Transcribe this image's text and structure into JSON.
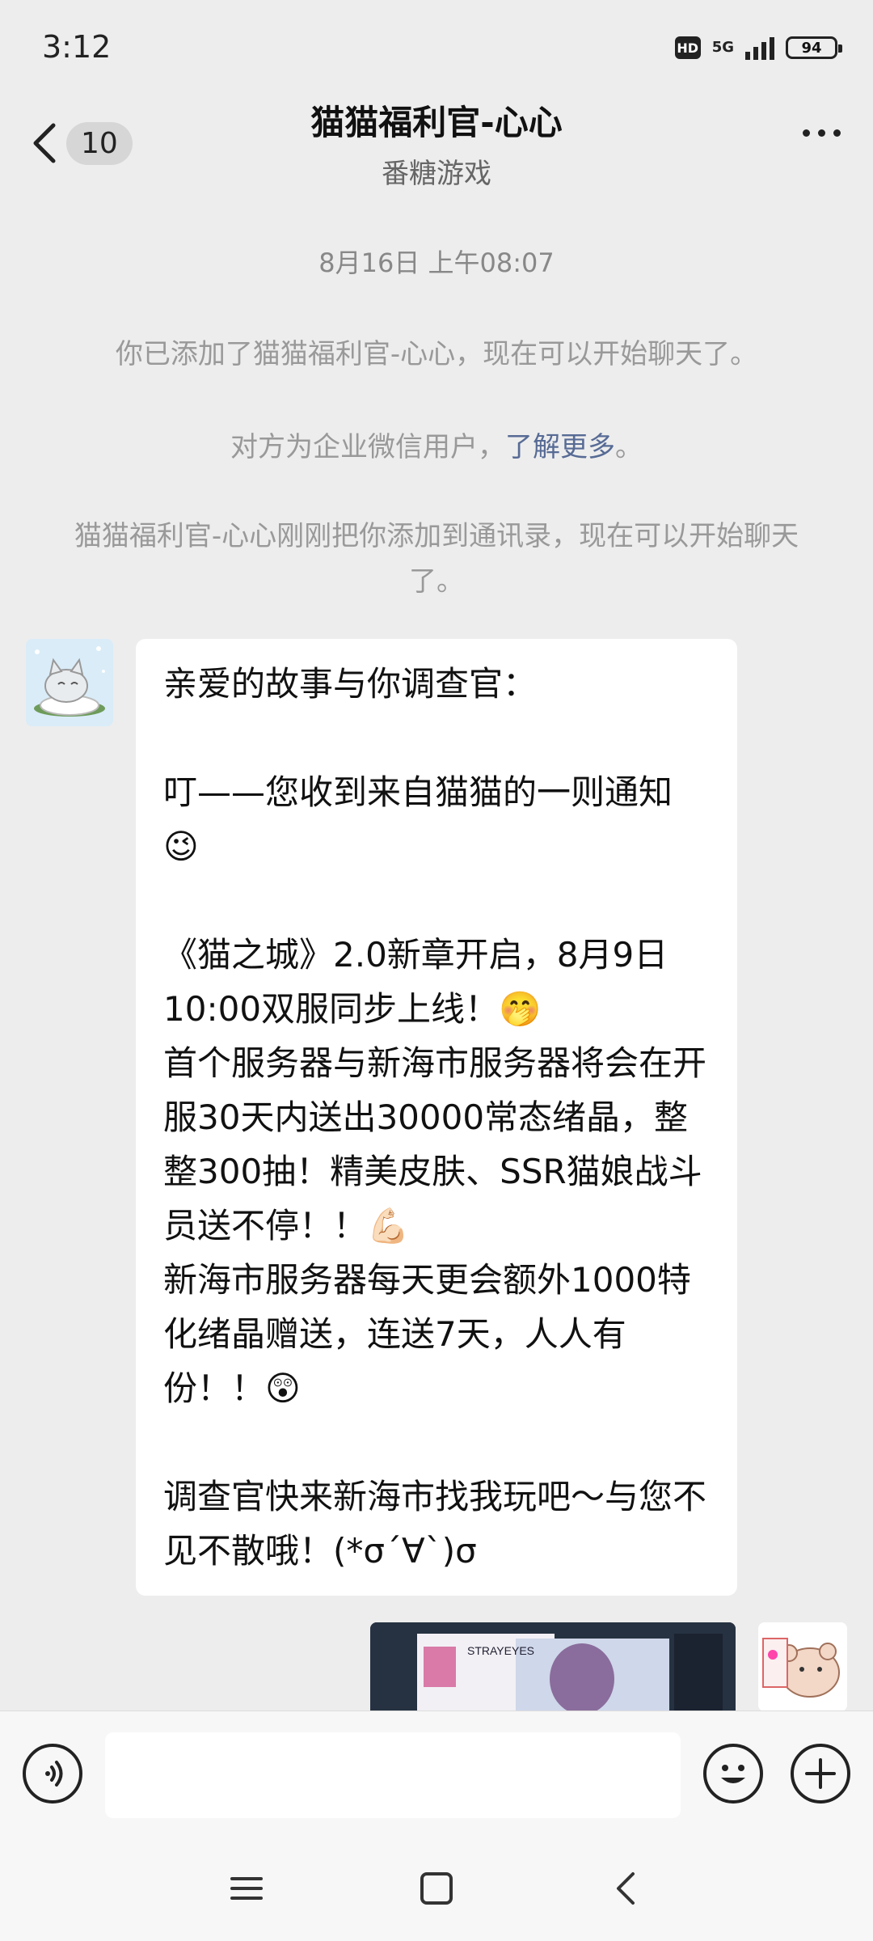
{
  "status": {
    "time": "3:12",
    "hd": "HD",
    "network": "5G",
    "battery": "94"
  },
  "nav": {
    "unread_count": "10",
    "title": "猫猫福利官-心心",
    "subtitle": "番糖游戏"
  },
  "chat": {
    "timestamp": "8月16日 上午08:07",
    "system_messages": {
      "added": "你已添加了猫猫福利官-心心，现在可以开始聊天了。",
      "enterprise_prefix": "对方为企业微信用户，",
      "enterprise_link": "了解更多",
      "enterprise_suffix": "。",
      "contact_added": "猫猫福利官-心心刚刚把你添加到通讯录，现在可以开始聊天了。"
    },
    "message": {
      "text": "亲爱的故事与你调查官：\n\n叮——您收到来自猫猫的一则通知 😉\n\n《猫之城》2.0新章开启，8月9日10:00双服同步上线！🤭\n首个服务器与新海市服务器将会在开服30天内送出30000常态绪晶，整整300抽！精美皮肤、SSR猫娘战斗员送不停！！💪🏻\n新海市服务器每天更会额外1000特化绪晶赠送，连送7天，人人有份！！😲\n\n调查官快来新海市找我玩吧～与您不见不散哦！(*σ´∀`)σ"
    },
    "image_preview": {
      "title_text": "STRAYEYES"
    }
  },
  "input": {
    "placeholder": ""
  },
  "colors": {
    "background": "#ededed",
    "bubble": "#ffffff",
    "link": "#576b95",
    "system_text": "#999999"
  }
}
